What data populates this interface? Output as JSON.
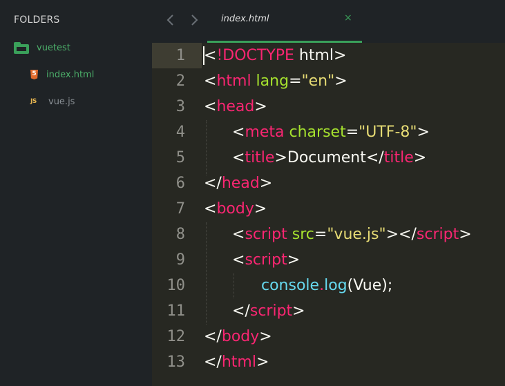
{
  "sidebar": {
    "title": "FOLDERS",
    "folder": {
      "name": "vuetest"
    },
    "files": [
      {
        "name": "index.html",
        "icon": "html5-icon",
        "icon_text": "5"
      },
      {
        "name": "vue.js",
        "icon": "js-icon",
        "icon_text": "JS"
      }
    ]
  },
  "tabs": {
    "active_tab": {
      "label": "index.html",
      "close": "×"
    }
  },
  "editor": {
    "line_numbers": [
      "1",
      "2",
      "3",
      "4",
      "5",
      "6",
      "7",
      "8",
      "9",
      "10",
      "11",
      "12",
      "13"
    ],
    "tokens": {
      "l1": [
        "<",
        "!DOCTYPE",
        " html",
        ">"
      ],
      "l2": [
        "<",
        "html",
        " lang",
        "=",
        "\"en\"",
        ">"
      ],
      "l3": [
        "<",
        "head",
        ">"
      ],
      "l4": [
        "<",
        "meta",
        " charset",
        "=",
        "\"UTF-8\"",
        ">"
      ],
      "l5": [
        "<",
        "title",
        ">",
        "Document",
        "</",
        "title",
        ">"
      ],
      "l6": [
        "</",
        "head",
        ">"
      ],
      "l7": [
        "<",
        "body",
        ">"
      ],
      "l8": [
        "<",
        "script",
        " src",
        "=",
        "\"vue.js\"",
        "></",
        "script",
        ">"
      ],
      "l9": [
        "<",
        "script",
        ">"
      ],
      "l10": [
        "console",
        ".",
        "log",
        "(Vue);"
      ],
      "l11": [
        "</",
        "script",
        ">"
      ],
      "l12": [
        "</",
        "body",
        ">"
      ],
      "l13": [
        "</",
        "html",
        ">"
      ]
    }
  },
  "colors": {
    "sidebar_bg": "#1f2326",
    "editor_bg": "#272822",
    "accent": "#3aa05a",
    "tag": "#f92672",
    "attr": "#a6e22e",
    "string": "#e6db74",
    "function": "#66d9ef"
  }
}
